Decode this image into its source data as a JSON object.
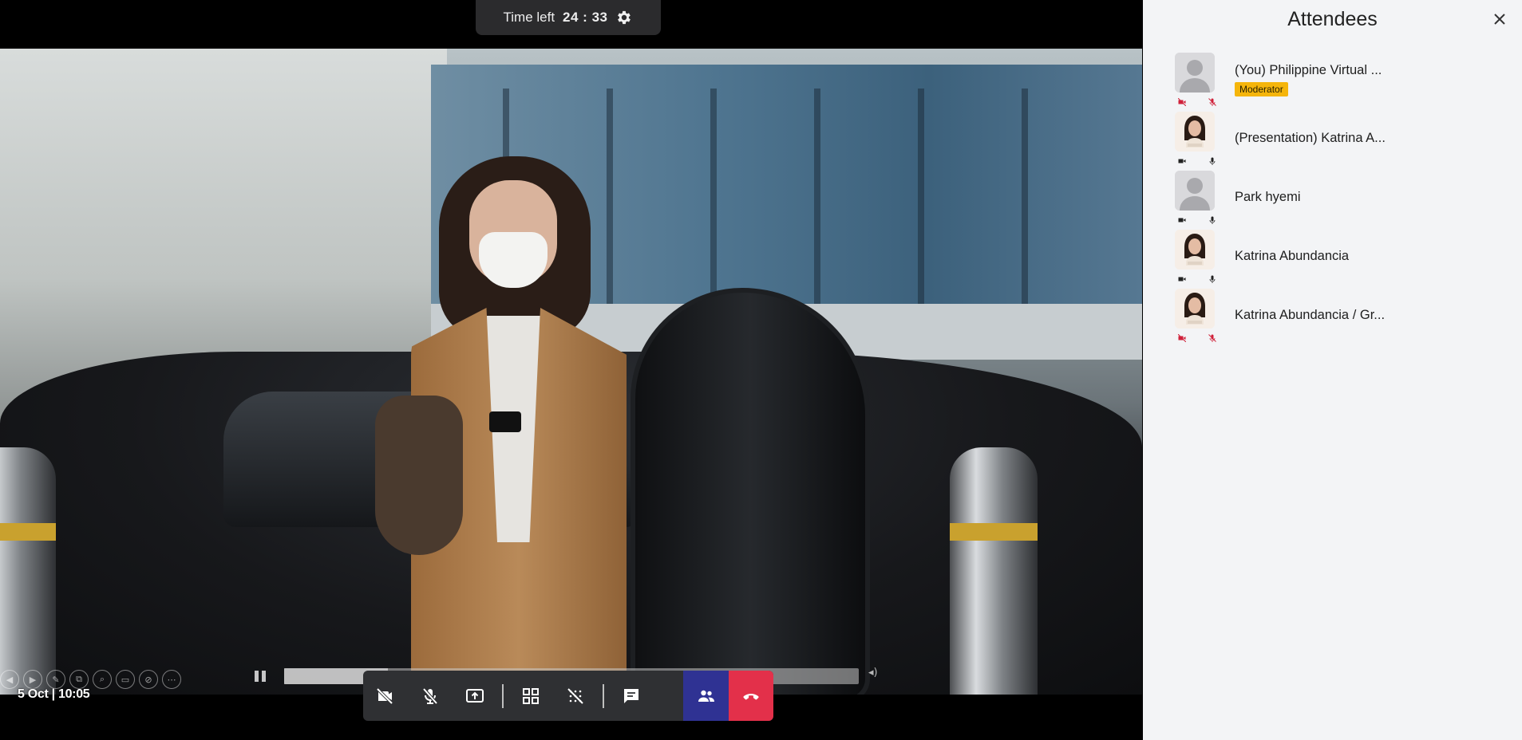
{
  "meeting": {
    "timer_label": "Time left",
    "timer_value": "24 : 33",
    "datetime": "5 Oct | 10:05",
    "media_progress": 0.18
  },
  "controls": {
    "items": [
      {
        "name": "camera-off-icon",
        "state": "off"
      },
      {
        "name": "mic-off-icon",
        "state": "off"
      },
      {
        "name": "share-screen-icon"
      },
      {
        "name": "grid-layout-icon"
      },
      {
        "name": "background-effect-icon"
      },
      {
        "name": "chat-icon"
      },
      {
        "name": "attendees-icon",
        "state": "active"
      },
      {
        "name": "hang-up-icon"
      }
    ],
    "active_color": "#2f3293",
    "hangup_color": "#e3304a"
  },
  "sidebar": {
    "title": "Attendees",
    "attendees": [
      {
        "name": "(You) Philippine Virtual ...",
        "badge": "Moderator",
        "avatar": "placeholder",
        "cam": "off",
        "mic": "off"
      },
      {
        "name": "(Presentation) Katrina A...",
        "avatar": "photo",
        "cam": "on",
        "mic": "on"
      },
      {
        "name": "Park hyemi",
        "avatar": "placeholder",
        "cam": "on",
        "mic": "on"
      },
      {
        "name": "Katrina Abundancia",
        "avatar": "photo",
        "cam": "on",
        "mic": "on"
      },
      {
        "name": "Katrina Abundancia / Gr...",
        "avatar": "photo",
        "cam": "off",
        "mic": "off"
      }
    ],
    "badge_color": "#f5b50b",
    "off_color": "#d0213a"
  }
}
